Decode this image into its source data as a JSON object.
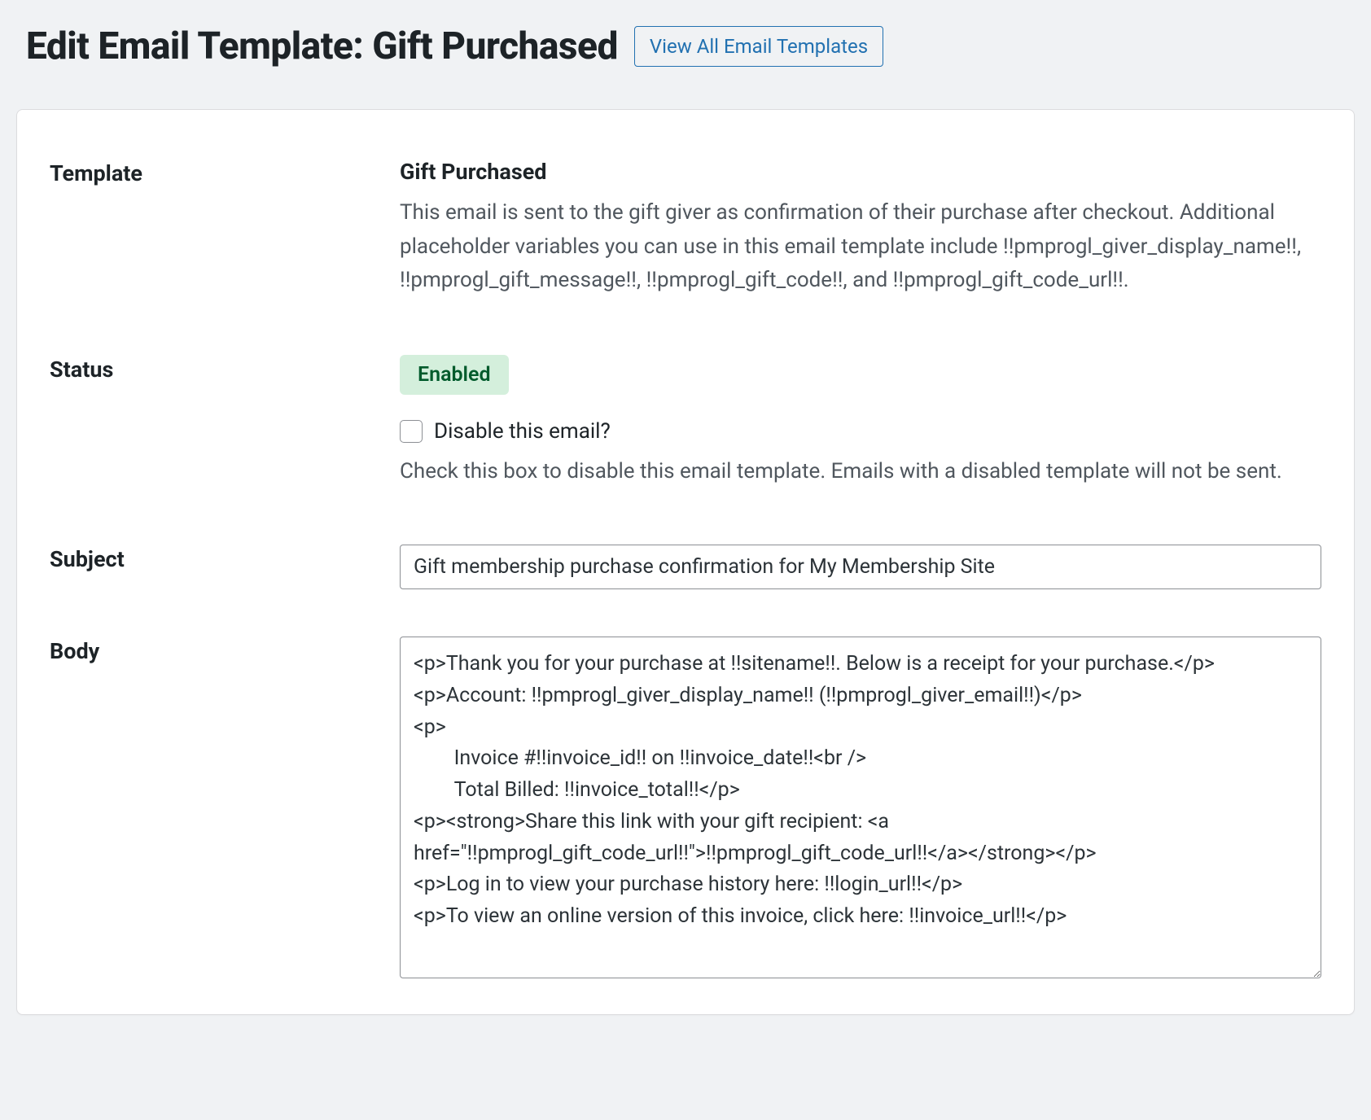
{
  "header": {
    "title": "Edit Email Template: Gift Purchased",
    "view_all_label": "View All Email Templates"
  },
  "template": {
    "label": "Template",
    "name": "Gift Purchased",
    "description": "This email is sent to the gift giver as confirmation of their purchase after checkout. Additional placeholder variables you can use in this email template include !!pmprogl_giver_display_name!!, !!pmprogl_gift_message!!, !!pmprogl_gift_code!!, and !!pmprogl_gift_code_url!!."
  },
  "status": {
    "label": "Status",
    "badge": "Enabled",
    "checkbox_label": "Disable this email?",
    "help": "Check this box to disable this email template. Emails with a disabled template will not be sent."
  },
  "subject": {
    "label": "Subject",
    "value": "Gift membership purchase confirmation for My Membership Site"
  },
  "body": {
    "label": "Body",
    "value": "<p>Thank you for your purchase at !!sitename!!. Below is a receipt for your purchase.</p>\n<p>Account: !!pmprogl_giver_display_name!! (!!pmprogl_giver_email!!)</p>\n<p>\n        Invoice #!!invoice_id!! on !!invoice_date!!<br />\n        Total Billed: !!invoice_total!!</p>\n<p><strong>Share this link with your gift recipient: <a href=\"!!pmprogl_gift_code_url!!\">!!pmprogl_gift_code_url!!</a></strong></p>\n<p>Log in to view your purchase history here: !!login_url!!</p>\n<p>To view an online version of this invoice, click here: !!invoice_url!!</p>"
  }
}
